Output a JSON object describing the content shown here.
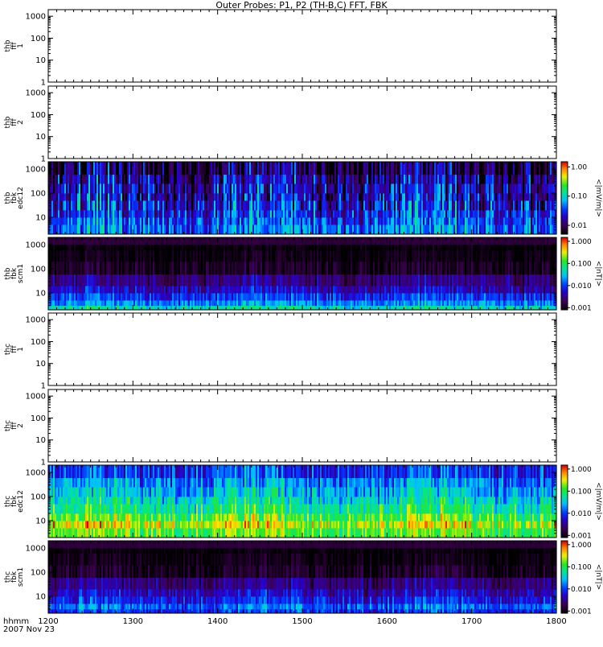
{
  "title": "Outer Probes: P1, P2 (TH-B,C) FFT, FBK",
  "time_axis": {
    "row_label_1": "hhmm",
    "row_label_2": "2007 Nov 23",
    "ticks": [
      "1200",
      "1300",
      "1400",
      "1500",
      "1600",
      "1700",
      "1800"
    ],
    "range": [
      1200,
      1800
    ]
  },
  "chart_data": [
    {
      "type": "heatmap",
      "ylabel": [
        "thb",
        "fff",
        "1"
      ],
      "y_ticks": [
        "1",
        "10",
        "100",
        "1000"
      ],
      "ylog": true,
      "ylim": [
        1,
        2000
      ],
      "has_data": false
    },
    {
      "type": "heatmap",
      "ylabel": [
        "thb",
        "fff",
        "2"
      ],
      "y_ticks": [
        "1",
        "10",
        "100",
        "1000"
      ],
      "ylog": true,
      "ylim": [
        1,
        2000
      ],
      "has_data": false
    },
    {
      "type": "heatmap",
      "ylabel": [
        "thb",
        "fbk",
        "edc12"
      ],
      "y_ticks": [
        "10",
        "100",
        "1000"
      ],
      "ylog": true,
      "ylim": [
        2,
        2000
      ],
      "has_data": true,
      "colorbar": {
        "label": "<|mV/m|>",
        "ticks": [
          "1.00",
          "0.10",
          "0.01"
        ],
        "range": [
          0.005,
          1.5
        ],
        "log": true
      },
      "bands": [
        2,
        5,
        10,
        20,
        50,
        100,
        250,
        600,
        2000
      ],
      "band_levels": [
        0.05,
        0.04,
        0.03,
        0.025,
        0.02,
        0.02,
        0.015,
        0.01
      ],
      "band_spread": [
        0.5,
        0.5,
        0.6,
        0.7,
        0.7,
        0.7,
        0.7,
        0.7
      ],
      "seed": 11
    },
    {
      "type": "heatmap",
      "ylabel": [
        "thb",
        "fbk",
        "scm1"
      ],
      "y_ticks": [
        "10",
        "100",
        "1000"
      ],
      "ylog": true,
      "ylim": [
        2,
        2000
      ],
      "has_data": true,
      "colorbar": {
        "label": "<|nT|>",
        "ticks": [
          "1.000",
          "0.100",
          "0.010",
          "0.001"
        ],
        "range": [
          0.0008,
          1.5
        ],
        "log": true
      },
      "bands": [
        2,
        3,
        5,
        10,
        20,
        60,
        200,
        600,
        1000,
        2000
      ],
      "band_levels": [
        0.05,
        0.02,
        0.01,
        0.005,
        0.003,
        0.0012,
        0.001,
        0.0009,
        0.0015
      ],
      "band_spread": [
        0.45,
        0.45,
        0.45,
        0.45,
        0.4,
        0.3,
        0.2,
        0.15,
        0.05
      ],
      "seed": 23
    },
    {
      "type": "heatmap",
      "ylabel": [
        "thc",
        "fff",
        "1"
      ],
      "y_ticks": [
        "1",
        "10",
        "100",
        "1000"
      ],
      "ylog": true,
      "ylim": [
        1,
        2000
      ],
      "has_data": false
    },
    {
      "type": "heatmap",
      "ylabel": [
        "thc",
        "fff",
        "2"
      ],
      "y_ticks": [
        "1",
        "10",
        "100",
        "1000"
      ],
      "ylog": true,
      "ylim": [
        1,
        2000
      ],
      "has_data": false
    },
    {
      "type": "heatmap",
      "ylabel": [
        "thc",
        "fbk",
        "edc12"
      ],
      "y_ticks": [
        "10",
        "100",
        "1000"
      ],
      "ylog": true,
      "ylim": [
        2,
        2000
      ],
      "has_data": true,
      "colorbar": {
        "label": "<|mV/m|>",
        "ticks": [
          "1.000",
          "0.100",
          "0.010",
          "0.001"
        ],
        "range": [
          0.0008,
          1.5
        ],
        "log": true
      },
      "bands": [
        2,
        5,
        10,
        20,
        50,
        100,
        250,
        600,
        2000
      ],
      "band_levels": [
        0.15,
        0.3,
        0.15,
        0.08,
        0.05,
        0.03,
        0.02,
        0.01
      ],
      "band_spread": [
        0.5,
        0.6,
        0.6,
        0.6,
        0.6,
        0.6,
        0.6,
        0.6
      ],
      "seed": 37
    },
    {
      "type": "heatmap",
      "ylabel": [
        "thc",
        "fbk",
        "scm1"
      ],
      "y_ticks": [
        "10",
        "100",
        "1000"
      ],
      "ylog": true,
      "ylim": [
        2,
        2000
      ],
      "has_data": true,
      "colorbar": {
        "label": "<|nT|>",
        "ticks": [
          "1.000",
          "0.100",
          "0.010",
          "0.001"
        ],
        "range": [
          0.0008,
          1.5
        ],
        "log": true
      },
      "bands": [
        2,
        3,
        5,
        10,
        20,
        60,
        200,
        600,
        1000,
        2000
      ],
      "band_levels": [
        0.01,
        0.015,
        0.008,
        0.005,
        0.003,
        0.0012,
        0.001,
        0.0009,
        0.0015
      ],
      "band_spread": [
        0.45,
        0.45,
        0.45,
        0.45,
        0.4,
        0.3,
        0.2,
        0.15,
        0.05
      ],
      "seed": 53
    }
  ]
}
